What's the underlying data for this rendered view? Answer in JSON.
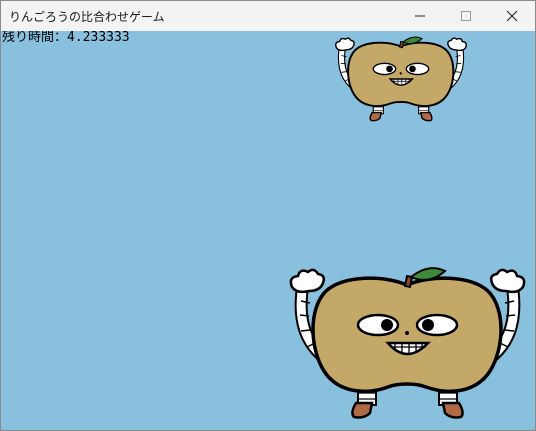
{
  "window": {
    "title": "りんごろうの比合わせゲーム",
    "minimize_glyph": "—",
    "maximize_glyph": "☐",
    "close_glyph": "✕"
  },
  "game": {
    "timer_label": "残り時間：",
    "timer_value": "4.233333",
    "background_color": "#89c0de",
    "characters": [
      {
        "name": "ringorou-small",
        "icon": "apple-character-icon"
      },
      {
        "name": "ringorou-large",
        "icon": "apple-character-icon"
      }
    ]
  }
}
